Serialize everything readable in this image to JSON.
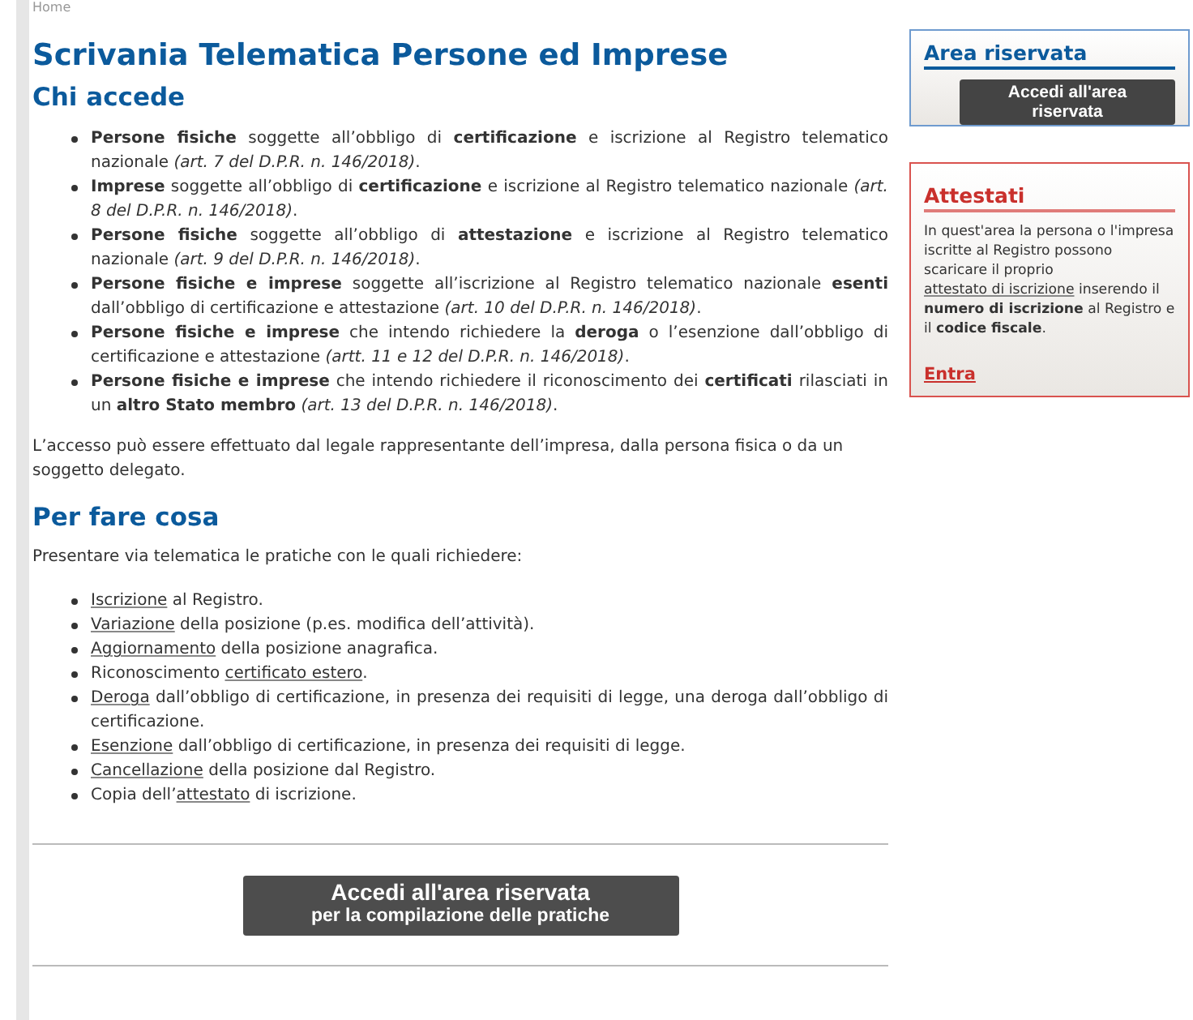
{
  "breadcrumb": "Home",
  "title": "Scrivania Telematica Persone ed Imprese",
  "who": {
    "heading": "Chi accede",
    "items": [
      "**Persone fisiche** soggette all’obbligo di **certificazione** e iscrizione al Registro telematico nazionale *(art. 7 del D.P.R. n. 146/2018)*.",
      "**Imprese** soggette all’obbligo di **certificazione** e iscrizione al Registro telematico nazionale *(art. 8 del D.P.R. n. 146/2018)*.",
      "**Persone fisiche** soggette all’obbligo di **attestazione** e iscrizione al Registro telematico nazionale *(art. 9 del D.P.R. n. 146/2018)*.",
      "**Persone fisiche e imprese** soggette all’iscrizione al Registro telematico nazionale **esenti** dall’obbligo di certificazione e attestazione *(art. 10 del D.P.R. n. 146/2018)*.",
      "**Persone fisiche e imprese** che intendo richiedere la **deroga** o l’esenzione dall’obbligo di certificazione e attestazione *(artt. 11 e 12 del D.P.R. n. 146/2018)*.",
      "**Persone fisiche e imprese** che intendo richiedere il riconoscimento dei **certificati** rilasciati in un **altro Stato membro** *(art. 13 del D.P.R. n. 146/2018)*."
    ],
    "note": "L’accesso può essere effettuato dal legale rappresentante dell’impresa, dalla persona fisica o da un soggetto delegato."
  },
  "what": {
    "heading": "Per fare cosa",
    "intro": "Presentare via telematica le pratiche con le quali richiedere:",
    "items": [
      {
        "link": "Iscrizione",
        "after": " al Registro."
      },
      {
        "link": "Variazione",
        "after": " della posizione (p.es. modifica dell’attività)."
      },
      {
        "link": "Aggiornamento",
        "after": " della posizione anagrafica."
      },
      {
        "before": "Riconoscimento ",
        "link": "certificato estero",
        "after": "."
      },
      {
        "link": "Deroga",
        "after": " dall’obbligo di certificazione, in presenza dei requisiti di legge, una deroga dall’obbligo di certificazione."
      },
      {
        "link": "Esenzione",
        "after": " dall’obbligo di certificazione, in presenza dei requisiti di legge."
      },
      {
        "link": "Cancellazione",
        "after": " della posizione dal Registro."
      },
      {
        "before": "Copia dell’",
        "link": "attestato",
        "after": " di iscrizione."
      }
    ]
  },
  "main_button": {
    "line_1": "Accedi all'area riservata",
    "line_2": "per la compilazione delle pratiche"
  },
  "sidebar": [
    {
      "kind": "login",
      "title": "Area riservata",
      "button": "Accedi all'area riservata"
    },
    {
      "kind": "certificates",
      "title": "Attestati",
      "text": {
        "before": "In quest'area la persona o l'impresa iscritte al Registro possono scaricare il proprio ",
        "link": "attestato di iscrizione",
        "after": " inserendo il **numero di iscrizione** al Registro e il **codice fiscale**."
      },
      "link": "Entra"
    }
  ]
}
